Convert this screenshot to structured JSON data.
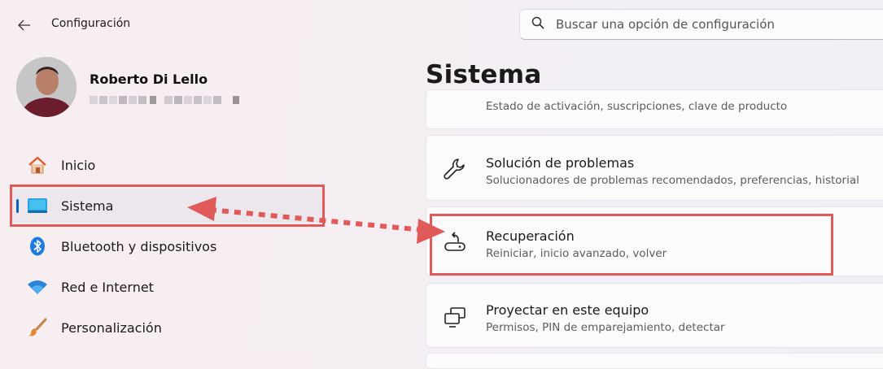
{
  "window": {
    "title": "Configuración"
  },
  "search": {
    "placeholder": "Buscar una opción de configuración"
  },
  "user": {
    "name": "Roberto Di Lello"
  },
  "sidebar": {
    "items": [
      {
        "label": "Inicio",
        "icon": "home-icon"
      },
      {
        "label": "Sistema",
        "icon": "monitor-icon",
        "selected": true
      },
      {
        "label": "Bluetooth y dispositivos",
        "icon": "bluetooth-icon"
      },
      {
        "label": "Red e Internet",
        "icon": "wifi-icon"
      },
      {
        "label": "Personalización",
        "icon": "paintbrush-icon"
      }
    ]
  },
  "main": {
    "title": "Sistema",
    "cards": [
      {
        "title": "",
        "subtitle": "Estado de activación, suscripciones, clave de producto",
        "icon": ""
      },
      {
        "title": "Solución de problemas",
        "subtitle": "Solucionadores de problemas recomendados, preferencias, historial",
        "icon": "wrench-icon"
      },
      {
        "title": "Recuperación",
        "subtitle": "Reiniciar, inicio avanzado, volver",
        "icon": "recovery-icon"
      },
      {
        "title": "Proyectar en este equipo",
        "subtitle": "Permisos, PIN de emparejamiento, detectar",
        "icon": "project-screen-icon"
      }
    ]
  },
  "annotations": {
    "color": "#e05a5a"
  },
  "accent": "#0067c0"
}
